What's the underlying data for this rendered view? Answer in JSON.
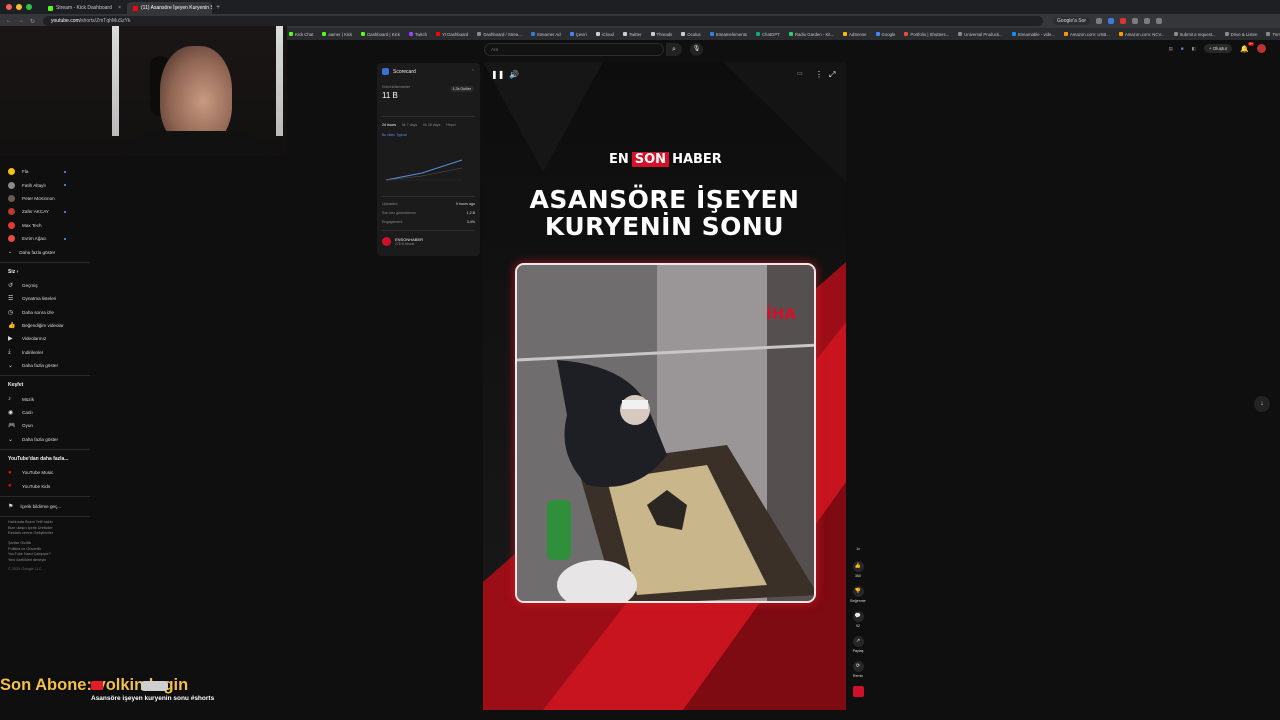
{
  "browser": {
    "tabs": [
      {
        "label": "Stream - Kick Dashboard",
        "color": "#53fc18",
        "active": false
      },
      {
        "label": "(11) Asansöre İşeyen Kuryenin Sonu",
        "color": "#ff0000",
        "active": true
      }
    ],
    "url_host": "youtube.com",
    "url_path": "/shorts/ZmTqhMuSzYk",
    "search_chip": "Google'a Sor",
    "bookmarks": [
      {
        "label": "Kick Chat",
        "color": "#53fc18"
      },
      {
        "label": "aamer | Kick",
        "color": "#53fc18"
      },
      {
        "label": "Dashboard | Kick",
        "color": "#53fc18"
      },
      {
        "label": "Twitch",
        "color": "#9146ff"
      },
      {
        "label": "Yt Dashboard",
        "color": "#ff0000"
      },
      {
        "label": "Dashboard / Strea...",
        "color": "#888888"
      },
      {
        "label": "Streamer Ad",
        "color": "#3a7bd5"
      },
      {
        "label": "Çeviri",
        "color": "#4285f4"
      },
      {
        "label": "iCloud",
        "color": "#cccccc"
      },
      {
        "label": "Twitter",
        "color": "#cccccc"
      },
      {
        "label": "Threads",
        "color": "#cccccc"
      },
      {
        "label": "Oculus",
        "color": "#cccccc"
      },
      {
        "label": "Streamelements",
        "color": "#2f80ed"
      },
      {
        "label": "ChatGPT",
        "color": "#10a37f"
      },
      {
        "label": "Radio Garden - Kit...",
        "color": "#2ecc71"
      },
      {
        "label": "AdSense",
        "color": "#fbbc05"
      },
      {
        "label": "Google",
        "color": "#4285f4"
      },
      {
        "label": "Portfolio | Shutters...",
        "color": "#e74c3c"
      },
      {
        "label": "Universal Producti...",
        "color": "#888888"
      },
      {
        "label": "Streamable - vide...",
        "color": "#0f90fa"
      },
      {
        "label": "Amazon.com: USB...",
        "color": "#ff9900"
      },
      {
        "label": "Amazon.com: NCV...",
        "color": "#ff9900"
      },
      {
        "label": "Submit a request...",
        "color": "#888888"
      },
      {
        "label": "Drive & Listen",
        "color": "#888888"
      },
      {
        "label": "Tüm Yer İşaretleri",
        "color": "#888888"
      }
    ]
  },
  "youtube": {
    "search_placeholder": "Ara",
    "create_label": "Oluştur",
    "notif_count": "9+"
  },
  "sidebar": {
    "subscriptions": [
      {
        "label": "Fla",
        "color": "#f2c21b",
        "live": true
      },
      {
        "label": "Fatih Altaylı",
        "color": "#8a8a8a",
        "live": true
      },
      {
        "label": "Peter McKinnon",
        "color": "#6b5b4f",
        "live": false
      },
      {
        "label": "Zafer AKCAY",
        "color": "#c0392b",
        "live": true
      },
      {
        "label": "Max Tech",
        "color": "#e53935",
        "live": false
      },
      {
        "label": "Evrim Ağacı",
        "color": "#e74c3c",
        "live": true
      }
    ],
    "show_more": "Daha fazla göster",
    "you_header": "Siz",
    "you_items": [
      "Geçmiş",
      "Oynatma listeleri",
      "Daha sonra izle",
      "Beğendiğim videolar",
      "Videolarınız",
      "İndirilenler",
      "Daha fazla göster"
    ],
    "explore_header": "Keşfet",
    "explore_items": [
      "Müzik",
      "Canlı",
      "Oyun",
      "Daha fazla göster"
    ],
    "more_header": "YouTube'dan daha fazla...",
    "more_items": [
      "YouTube Music",
      "YouTube Kids"
    ],
    "report": "İçerik bildirme geç...",
    "footer1": [
      "Hakkında  Basın  Telif hakkı",
      "Bize ulaşın  İçerik Üreticiler",
      "Reklam verme  Geliştiriciler"
    ],
    "footer2": [
      "Şartlar  Gizlilik",
      "Politika ve Güvenlik",
      "YouTube Nasıl Çalışıyor?",
      "Yeni özellikleri deneyin"
    ],
    "copyright": "© 2025 Google LLC"
  },
  "scorecard": {
    "title": "Scorecard",
    "views_label": "Görüntülenmeler",
    "views": "11 B",
    "badge": "1,3x Outlier",
    "tabs": [
      "24 hours",
      "İlk 7 days",
      "İlk 28 days",
      "Hepsi"
    ],
    "legend": "Bu video  Typical",
    "rows": [
      {
        "label": "Uploaded",
        "value": "9 hours ago"
      },
      {
        "label": "Son kez görüntüleme",
        "value": "1,2 B"
      },
      {
        "label": "Engagement",
        "value": "3,4%"
      }
    ],
    "channel_name": "ENSONHABER",
    "channel_subs": "276 B Abone"
  },
  "video": {
    "brand_en": "EN",
    "brand_son": "SON",
    "brand_haber": "HABER",
    "headline_1": "ASANSÖRE İŞEYEN",
    "headline_2": "KURYENİN SONU",
    "watermark_i": "İ",
    "watermark_ha": "HA"
  },
  "actions": [
    {
      "icon": "like-icon",
      "glyph": "👍",
      "label": "360"
    },
    {
      "icon": "dislike-icon",
      "glyph": "👎",
      "label": "Beğenme"
    },
    {
      "icon": "comment-icon",
      "glyph": "💬",
      "label": "92"
    },
    {
      "icon": "share-icon",
      "glyph": "↗",
      "label": "Paylaş"
    },
    {
      "icon": "remix-icon",
      "glyph": "⟳",
      "label": "Remix"
    }
  ],
  "overlay": {
    "subscriber_text": "Son Abone: volkin login",
    "caption": "Asansöre işeyen kuryenin sonu #shorts"
  },
  "colors": {
    "brand_red": "#d4102a",
    "yt_red": "#ff0000",
    "overlay_gold": "#f5c04a"
  }
}
